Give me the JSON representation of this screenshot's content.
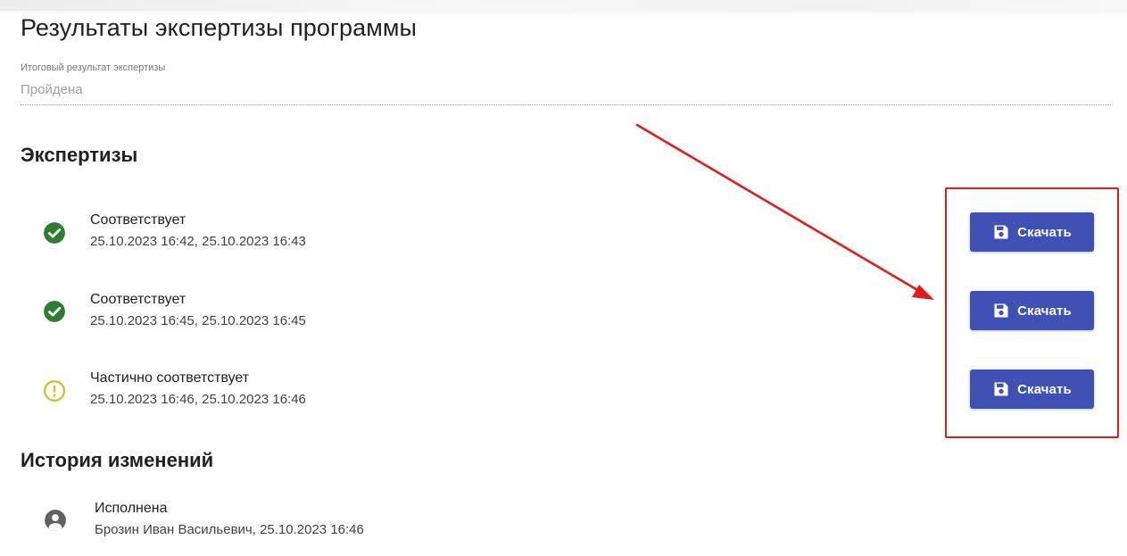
{
  "page": {
    "title": "Результаты экспертизы программы"
  },
  "final_result": {
    "label": "Итоговый результат экспертизы",
    "value": "Пройдена"
  },
  "expertise": {
    "heading": "Экспертизы",
    "items": [
      {
        "status": "Соответствует",
        "dates": "25.10.2023 16:42, 25.10.2023 16:43",
        "icon": "check-circle-icon",
        "status_color": "#2e7d32",
        "download_label": "Скачать"
      },
      {
        "status": "Соответствует",
        "dates": "25.10.2023 16:45, 25.10.2023 16:45",
        "icon": "check-circle-icon",
        "status_color": "#2e7d32",
        "download_label": "Скачать"
      },
      {
        "status": "Частично соответствует",
        "dates": "25.10.2023 16:46, 25.10.2023 16:46",
        "icon": "warning-circle-icon",
        "status_color": "#c0ca33",
        "download_label": "Скачать"
      }
    ]
  },
  "history": {
    "heading": "История изменений",
    "items": [
      {
        "status": "Исполнена",
        "detail": "Брозин Иван Васильевич, 25.10.2023 16:46",
        "icon": "user-circle-icon"
      }
    ]
  },
  "annotation": {
    "arrow_color": "#e21c1c",
    "box_color": "#e21c1c"
  },
  "theme": {
    "primary": "#3f51b5",
    "success": "#2e7d32",
    "warning": "#c0ca33"
  }
}
